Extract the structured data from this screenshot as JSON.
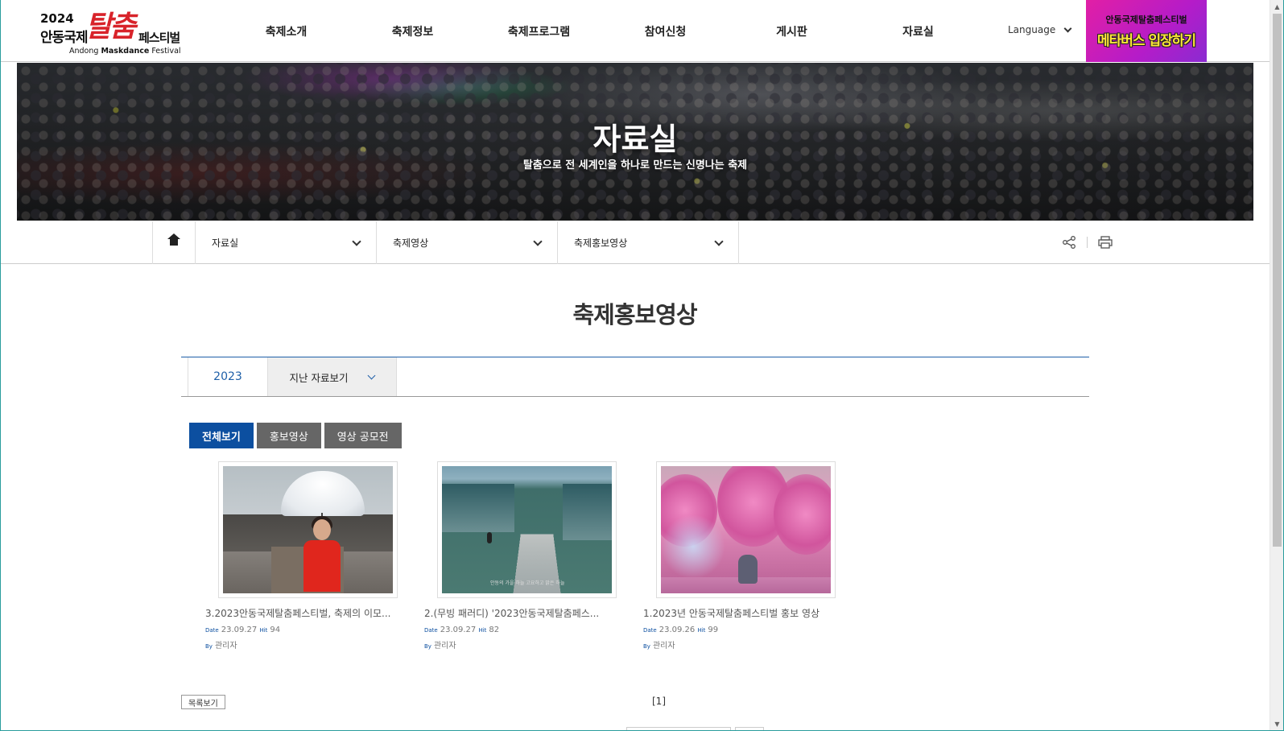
{
  "logo": {
    "year": "2024",
    "line1": "안동국제",
    "big": "탈춤",
    "line2": "페스티벌",
    "en_pre": "Andong ",
    "en_bold": "Maskdance",
    "en_post": " Festival"
  },
  "gnb": [
    {
      "label": "축제소개"
    },
    {
      "label": "축제정보"
    },
    {
      "label": "축제프로그램"
    },
    {
      "label": "참여신청"
    },
    {
      "label": "게시판"
    },
    {
      "label": "자료실"
    }
  ],
  "language": {
    "label": "Language"
  },
  "metaverse_banner": {
    "line1": "안동국제탈춤페스티벌",
    "line2": "메타버스 입장하기"
  },
  "hero": {
    "title": "자료실",
    "subtitle": "탈춤으로 전 세계인을 하나로 만드는 신명나는 축제"
  },
  "subnav": {
    "dropdowns": [
      {
        "label": "자료실"
      },
      {
        "label": "축제영상"
      },
      {
        "label": "축제홍보영상"
      }
    ]
  },
  "page_title": "축제홍보영상",
  "year_tabs": {
    "current": "2023",
    "past_label": "지난 자료보기"
  },
  "categories": [
    {
      "label": "전체보기",
      "active": true
    },
    {
      "label": "홍보영상",
      "active": false
    },
    {
      "label": "영상 공모전",
      "active": false
    }
  ],
  "meta_labels": {
    "date": "Date",
    "hit": "Hit",
    "by": "By"
  },
  "videos": [
    {
      "title": "3.2023안동국제탈춤페스티벌, 축제의 이모...",
      "date": "23.09.27",
      "hits": "94",
      "author": "관리자"
    },
    {
      "title": "2.(무빙 패러디) '2023안동국제탈춤페스...",
      "date": "23.09.27",
      "hits": "82",
      "author": "관리자",
      "caption": "안동의 가을 하늘 고요하고 맑은 하늘"
    },
    {
      "title": "1.2023년 안동국제탈춤페스티벌 홍보 영상",
      "date": "23.09.26",
      "hits": "99",
      "author": "관리자"
    }
  ],
  "list_button": "목록보기",
  "pagination": "[1]",
  "colors": {
    "accent_blue": "#0c4fa0",
    "brand_red": "#d8232a",
    "banner_magenta": "#e21fa5"
  }
}
